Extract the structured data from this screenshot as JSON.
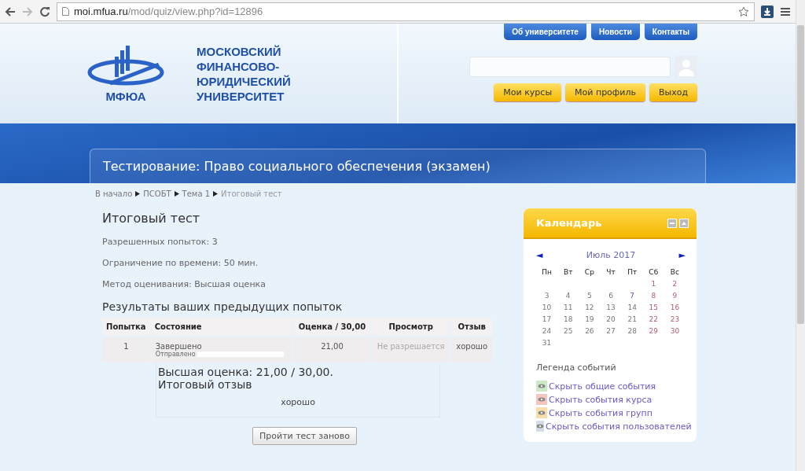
{
  "browser": {
    "url_host": "moi.mfua.ru",
    "url_path": "/mod/quiz/view.php?id=12896"
  },
  "header": {
    "logo_text": "МФЮА",
    "university_name": "МОСКОВСКИЙ ФИНАНСОВО-ЮРИДИЧЕСКИЙ УНИВЕРСИТЕТ",
    "top_links": [
      "Об университете",
      "Новости",
      "Контакты"
    ],
    "user_buttons": [
      "Мои курсы",
      "Мой профиль",
      "Выход"
    ]
  },
  "page_title": "Тестирование: Право социального обеспечения (экзамен)",
  "breadcrumbs": [
    {
      "label": "В начало",
      "current": false
    },
    {
      "label": "ПСОБТ",
      "current": false
    },
    {
      "label": "Тема 1",
      "current": false
    },
    {
      "label": "Итоговый тест",
      "current": true
    }
  ],
  "quiz": {
    "title": "Итоговый тест",
    "info": [
      "Разрешенных попыток: 3",
      "Ограничение по времени: 50 мин.",
      "Метод оценивания: Высшая оценка"
    ],
    "results_heading": "Результаты ваших предыдущих попыток",
    "table": {
      "columns": [
        "Попытка",
        "Состояние",
        "Оценка / 30,00",
        "Просмотр",
        "Отзыв"
      ],
      "rows": [
        {
          "attempt": "1",
          "state": "Завершено",
          "submitted": "Отправлено",
          "grade": "21,00",
          "review": "Не разрешается",
          "feedback": "хорошо"
        }
      ]
    },
    "best_grade": "Высшая оценка: 21,00 / 30,00.",
    "final_feedback_heading": "Итоговый отзыв",
    "final_feedback": "хорошо",
    "retry_button": "Пройти тест заново"
  },
  "calendar": {
    "title": "Календарь",
    "month": "Июль 2017",
    "prev": "◄",
    "next": "►",
    "weekdays": [
      "Пн",
      "Вт",
      "Ср",
      "Чт",
      "Пт",
      "Сб",
      "Вс"
    ],
    "weeks": [
      [
        {
          "kind": "blank"
        },
        {
          "kind": "blank"
        },
        {
          "kind": "blank"
        },
        {
          "kind": "blank"
        },
        {
          "kind": "blank"
        },
        {
          "d": "1",
          "kind": "weekend"
        },
        {
          "d": "2",
          "kind": "weekend"
        }
      ],
      [
        {
          "d": "3",
          "kind": "day"
        },
        {
          "d": "4",
          "kind": "day"
        },
        {
          "d": "5",
          "kind": "day"
        },
        {
          "d": "6",
          "kind": "day"
        },
        {
          "d": "7",
          "kind": "event"
        },
        {
          "d": "8",
          "kind": "weekend"
        },
        {
          "d": "9",
          "kind": "weekend"
        }
      ],
      [
        {
          "d": "10",
          "kind": "day"
        },
        {
          "d": "11",
          "kind": "day"
        },
        {
          "d": "12",
          "kind": "day"
        },
        {
          "d": "13",
          "kind": "day"
        },
        {
          "d": "14",
          "kind": "day"
        },
        {
          "d": "15",
          "kind": "weekend"
        },
        {
          "d": "16",
          "kind": "weekend"
        }
      ],
      [
        {
          "d": "17",
          "kind": "day"
        },
        {
          "d": "18",
          "kind": "day"
        },
        {
          "d": "19",
          "kind": "day"
        },
        {
          "d": "20",
          "kind": "day"
        },
        {
          "d": "21",
          "kind": "day"
        },
        {
          "d": "22",
          "kind": "weekend"
        },
        {
          "d": "23",
          "kind": "weekend"
        }
      ],
      [
        {
          "d": "24",
          "kind": "day"
        },
        {
          "d": "25",
          "kind": "day"
        },
        {
          "d": "26",
          "kind": "day"
        },
        {
          "d": "27",
          "kind": "day"
        },
        {
          "d": "28",
          "kind": "day"
        },
        {
          "d": "29",
          "kind": "weekend"
        },
        {
          "d": "30",
          "kind": "weekend"
        }
      ],
      [
        {
          "d": "31",
          "kind": "day"
        }
      ]
    ],
    "legend_title": "Легенда событий",
    "legend": [
      {
        "label": "Скрыть общие события",
        "color": "#cde8c4"
      },
      {
        "label": "Скрыть события курса",
        "color": "#f3c6c0"
      },
      {
        "label": "Скрыть события групп",
        "color": "#f7deaa"
      },
      {
        "label": "Скрыть события пользователей",
        "color": "#d4dde6"
      }
    ]
  }
}
